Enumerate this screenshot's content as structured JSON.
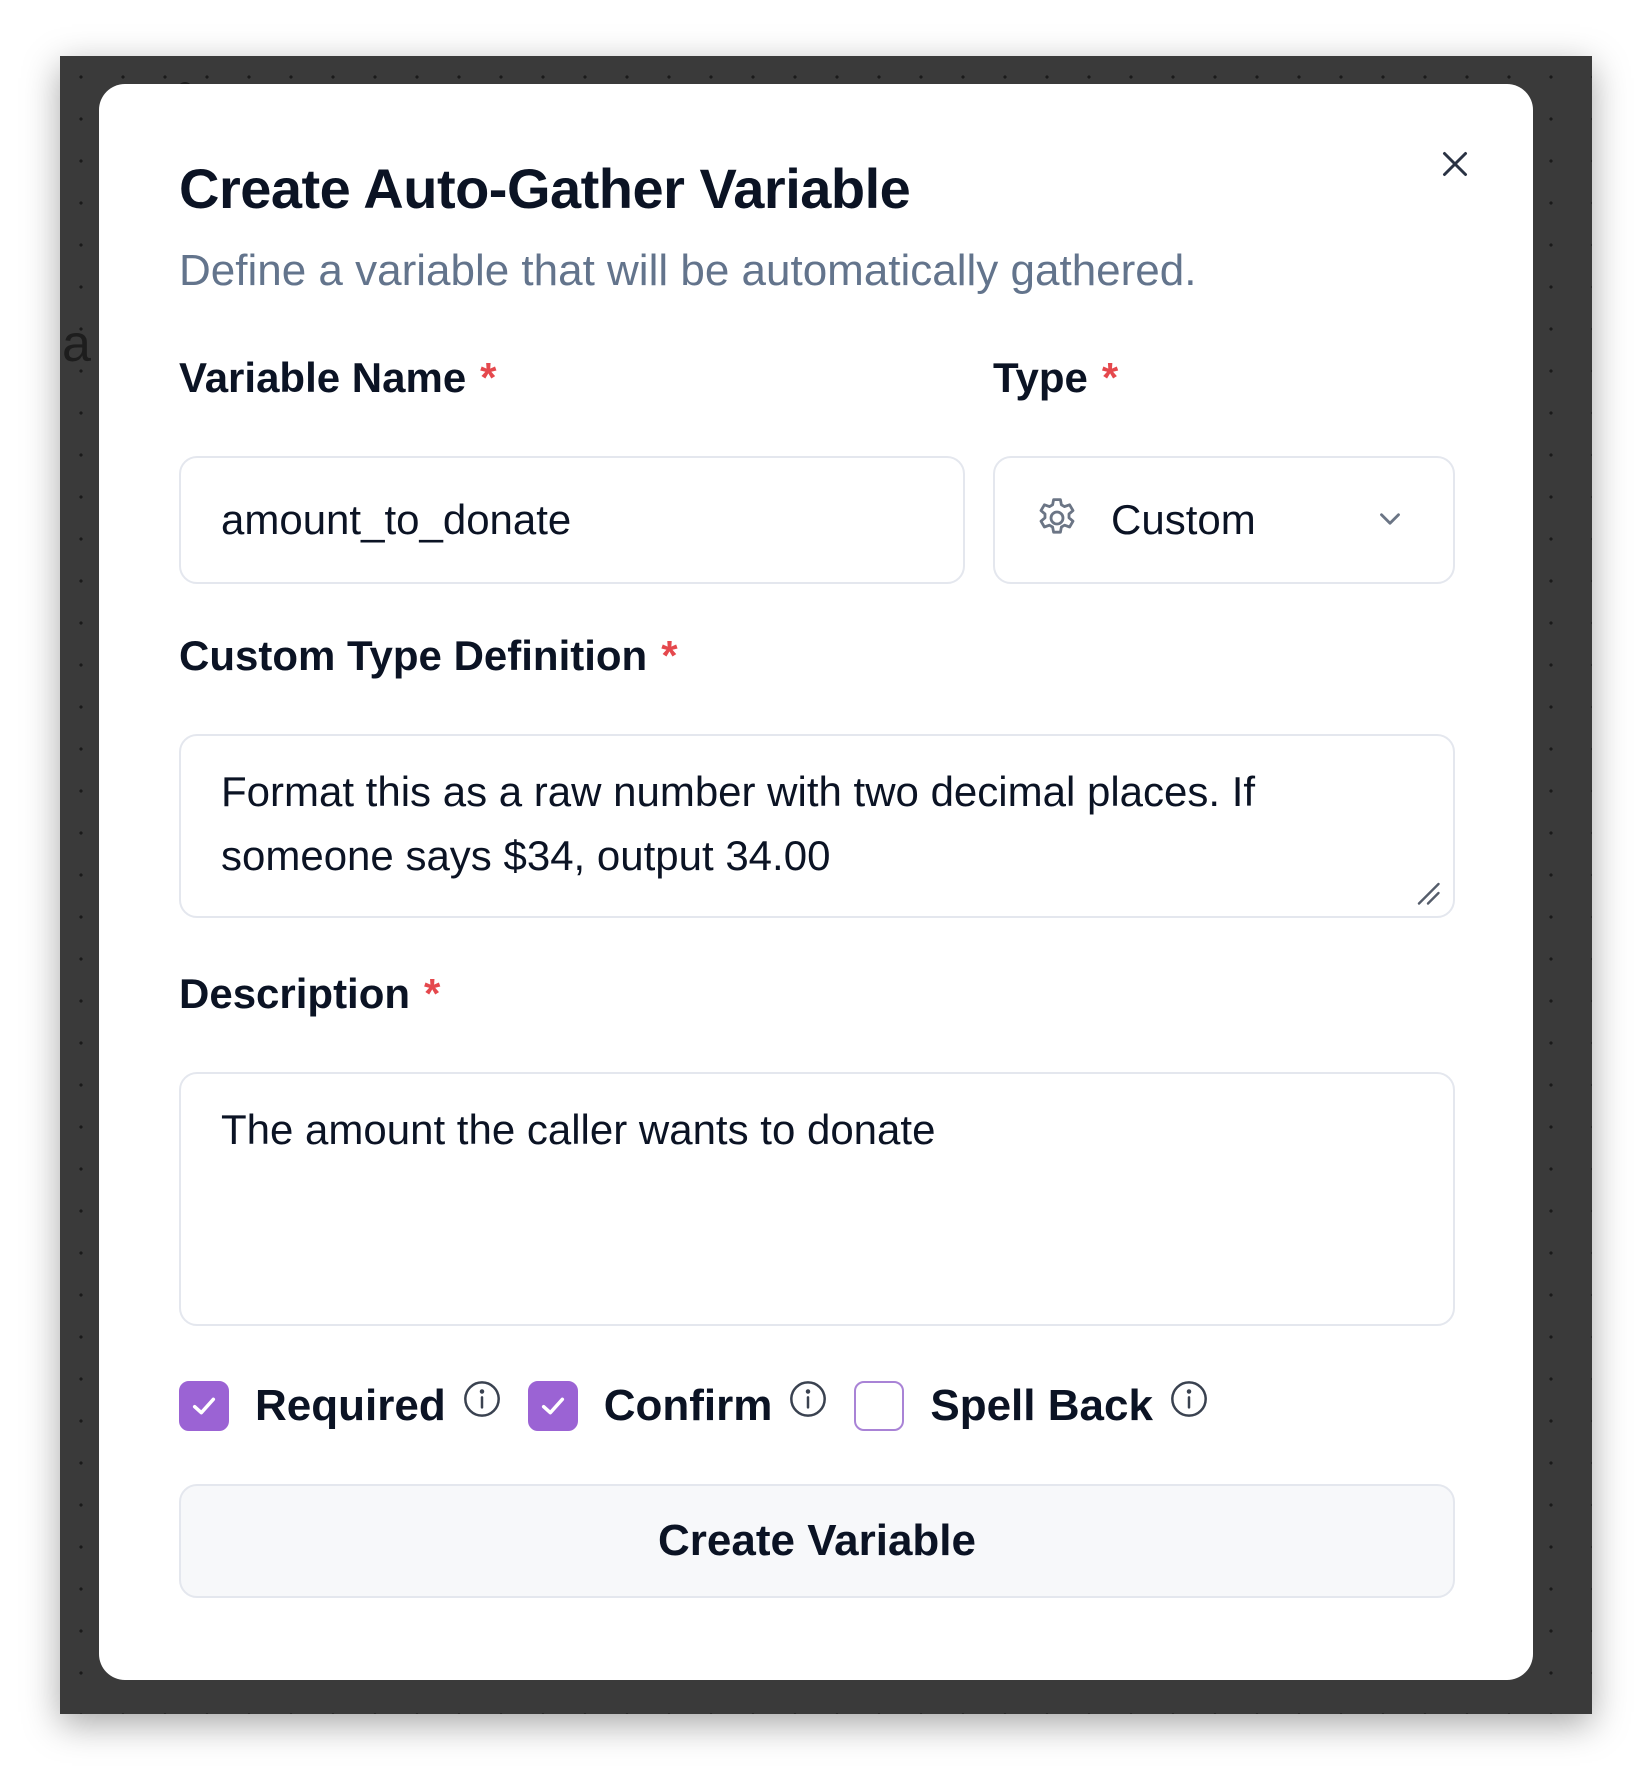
{
  "dialog": {
    "title": "Create Auto-Gather Variable",
    "subtitle": "Define a variable that will be automatically gathered.",
    "close_icon": "close-icon"
  },
  "background": {
    "partial_text": "a"
  },
  "fields": {
    "variable_name": {
      "label": "Variable Name",
      "required_mark": "*",
      "value": "amount_to_donate"
    },
    "type": {
      "label": "Type",
      "required_mark": "*",
      "value": "Custom",
      "icon": "gear-icon"
    },
    "custom_type_definition": {
      "label": "Custom Type Definition",
      "required_mark": "*",
      "value": "Format this as a raw number with two decimal places. If someone says $34, output 34.00"
    },
    "description": {
      "label": "Description",
      "required_mark": "*",
      "value": "The amount the caller wants to donate"
    }
  },
  "options": [
    {
      "label": "Required",
      "checked": true
    },
    {
      "label": "Confirm",
      "checked": true
    },
    {
      "label": "Spell Back",
      "checked": false
    }
  ],
  "submit_label": "Create Variable",
  "colors": {
    "accent": "#9b63d4",
    "required": "#e5484d",
    "subtitle": "#63748c",
    "text": "#0b1324",
    "border": "#e4e7ee",
    "backdrop": "#3a3a3a"
  }
}
